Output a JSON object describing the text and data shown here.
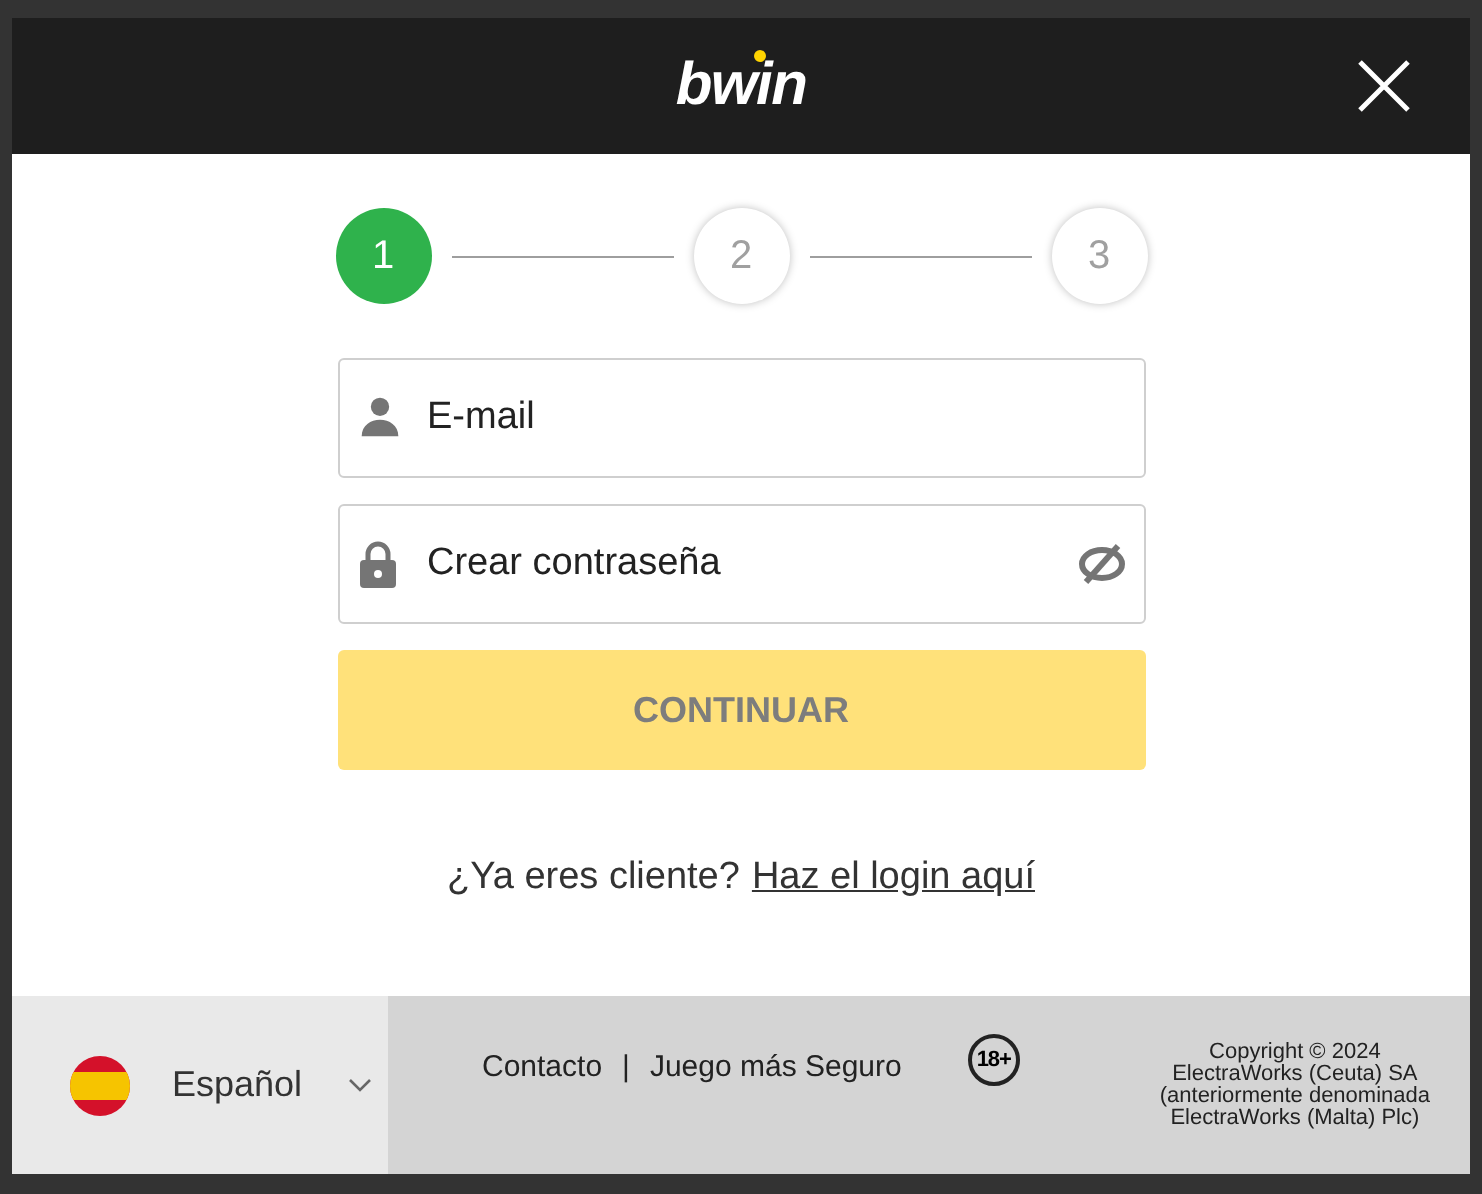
{
  "header": {
    "logo": "bwin"
  },
  "steps": [
    {
      "label": "1",
      "selected": true
    },
    {
      "label": "2",
      "selected": false
    },
    {
      "label": "3",
      "selected": false
    }
  ],
  "fields": [
    {
      "kind": "email",
      "placeholder": "E-mail"
    },
    {
      "kind": "password",
      "placeholder": "Crear contraseña"
    }
  ],
  "continue_button": {
    "label": "CONTINUAR",
    "disabled": true
  },
  "login_prompt": {
    "text": "¿Ya eres cliente?",
    "link": "Haz el login aquí"
  },
  "footer": {
    "language": "Español",
    "links": [
      "Contacto",
      "Juego más Seguro"
    ],
    "separator": "|",
    "age_badge": "18+",
    "copyright": [
      "Copyright © 2024",
      "ElectraWorks (Ceuta) SA",
      "(anteriormente denominada",
      "ElectraWorks (Malta) Plc)"
    ]
  }
}
